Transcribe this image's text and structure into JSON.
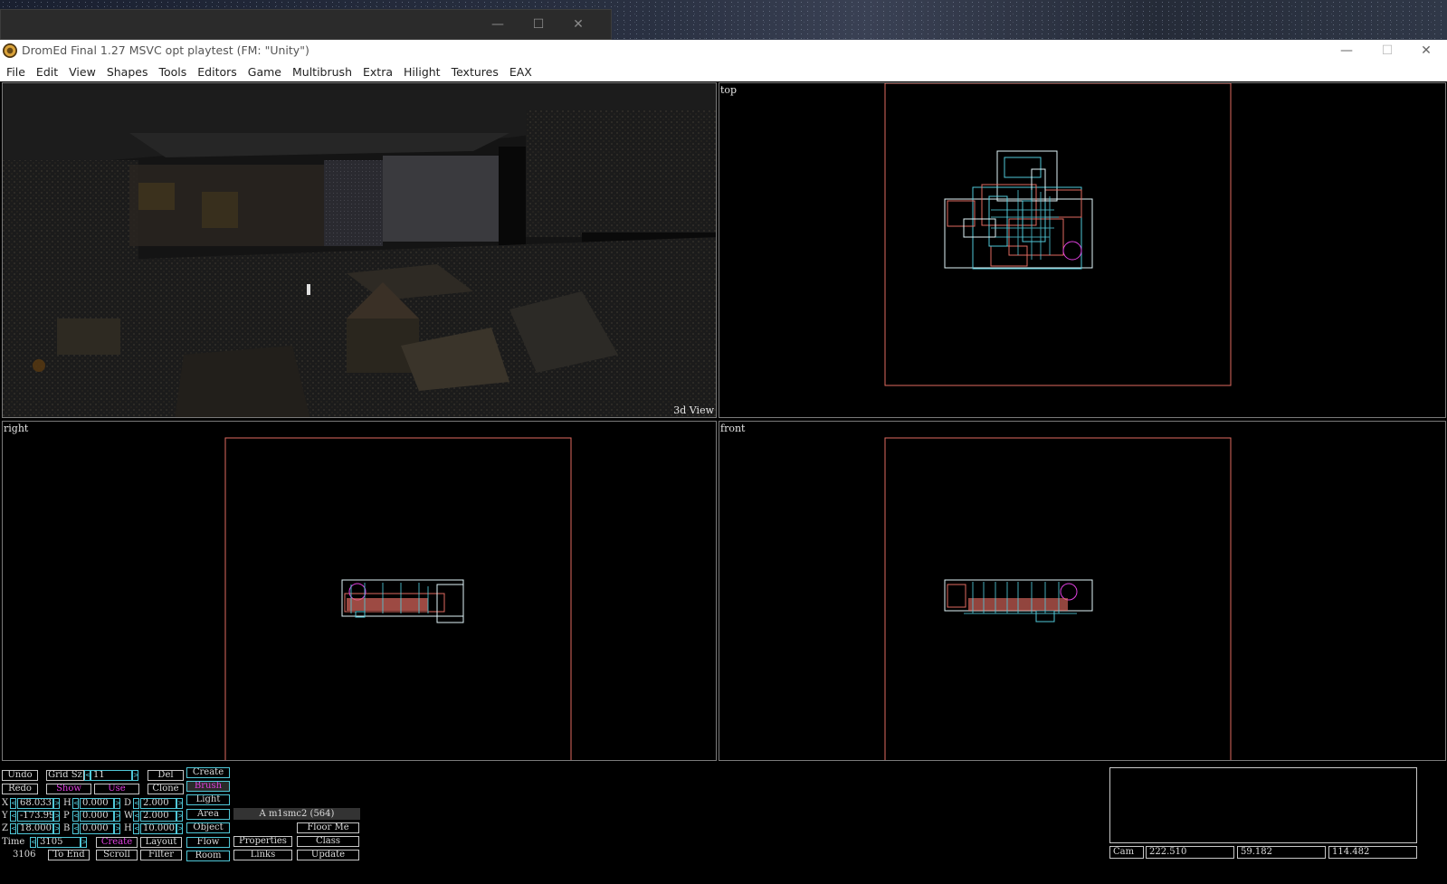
{
  "background_window": {
    "minimize": "—",
    "maximize": "☐",
    "close": "✕"
  },
  "window": {
    "title": "DromEd Final 1.27 MSVC opt playtest (FM: \"Unity\")",
    "minimize": "—",
    "maximize": "☐",
    "close": "✕"
  },
  "menu": [
    "File",
    "Edit",
    "View",
    "Shapes",
    "Tools",
    "Editors",
    "Game",
    "Multibrush",
    "Extra",
    "Hilight",
    "Textures",
    "EAX"
  ],
  "viewports": {
    "view3d": {
      "label": "3d View"
    },
    "top": {
      "label": "top"
    },
    "right": {
      "label": "right"
    },
    "front": {
      "label": "front"
    }
  },
  "toolbar": {
    "undo": "Undo",
    "redo": "Redo",
    "grid_label": "Grid Sz",
    "grid_value": "11",
    "show": "Show",
    "use": "Use",
    "del": "Del",
    "clone": "Clone",
    "create": "Create",
    "brush": "Brush",
    "light": "Light",
    "area": "Area",
    "object": "Object",
    "flow": "Flow",
    "room": "Room",
    "x_label": "X",
    "x_value": "68.033",
    "y_label": "Y",
    "y_value": "-173.99",
    "z_label": "Z",
    "z_value": "18.000",
    "h_label": "H",
    "h_value": "0.000",
    "p_label": "P",
    "p_value": "0.000",
    "b_label": "B",
    "b_value": "0.000",
    "d_label": "D",
    "d_value": "2.000",
    "w_label": "W",
    "w_value": "2.000",
    "hh_label": "H",
    "hh_value": "10.000",
    "time_label": "Time",
    "time_value": "3105",
    "time_total": "3106",
    "to_end": "To End",
    "create2": "Create",
    "layout": "Layout",
    "scroll": "Scroll",
    "filter": "Filter",
    "brush_info": "A m1smc2 (564)",
    "floor_me": "Floor Me",
    "properties": "Properties",
    "class": "Class",
    "links": "Links",
    "update": "Update"
  },
  "camera": {
    "label": "Cam",
    "x": "222.510",
    "y": "59.182",
    "z": "114.482"
  },
  "colors": {
    "accent": "#50c8d8",
    "magenta": "#e040e0",
    "salmon": "#e06a60"
  }
}
